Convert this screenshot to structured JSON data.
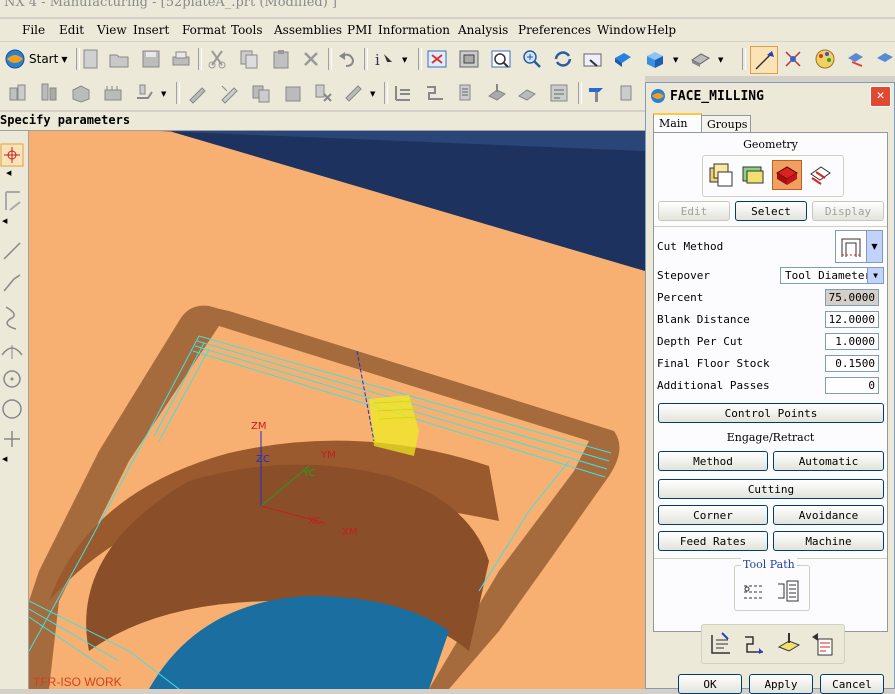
{
  "window": {
    "title": "NX 4 - Manufacturing - [52plateA_.prt (Modified) ]"
  },
  "menu": [
    {
      "label": "File"
    },
    {
      "label": "Edit"
    },
    {
      "label": "View"
    },
    {
      "label": "Insert"
    },
    {
      "label": "Format"
    },
    {
      "label": "Tools"
    },
    {
      "label": "Assemblies"
    },
    {
      "label": "PMI"
    },
    {
      "label": "Information"
    },
    {
      "label": "Analysis"
    },
    {
      "label": "Preferences"
    },
    {
      "label": "Window"
    },
    {
      "label": "Help"
    }
  ],
  "toolbar": {
    "start_label": "Start"
  },
  "status": {
    "prompt": "Specify parameters"
  },
  "viewport": {
    "view_label": "TFR-ISO WORK",
    "axes": {
      "zm": "ZM",
      "zc": "ZC",
      "ym": "YM",
      "yc": "YC",
      "xc": "XC",
      "xm": "XM"
    }
  },
  "colors": {
    "part_face": "#f7b071",
    "floor": "#1b6fa0",
    "pocket_wall": "#a0582a",
    "toolpath": "#40e0e0",
    "tool": "#f0f020",
    "background": "#1e3260"
  },
  "dialog": {
    "title": "FACE_MILLING",
    "tabs": [
      {
        "label": "Main",
        "active": true
      },
      {
        "label": "Groups",
        "active": false
      }
    ],
    "geometry_label": "Geometry",
    "edit_label": "Edit",
    "select_label": "Select",
    "display_label": "Display",
    "cut_method_label": "Cut Method",
    "stepover_label": "Stepover",
    "stepover_value": "Tool Diameter",
    "params": [
      {
        "label": "Percent",
        "value": "75.0000"
      },
      {
        "label": "Blank Distance",
        "value": "12.0000"
      },
      {
        "label": "Depth Per Cut",
        "value": "1.0000"
      },
      {
        "label": "Final Floor Stock",
        "value": "0.1500"
      },
      {
        "label": "Additional Passes",
        "value": "0"
      }
    ],
    "control_points_label": "Control Points",
    "engage_retract_label": "Engage/Retract",
    "method_label": "Method",
    "automatic_label": "Automatic",
    "cutting_label": "Cutting",
    "corner_label": "Corner",
    "avoidance_label": "Avoidance",
    "feed_rates_label": "Feed Rates",
    "machine_label": "Machine",
    "tool_path_label": "Tool Path",
    "ok_label": "OK",
    "apply_label": "Apply",
    "cancel_label": "Cancel"
  }
}
